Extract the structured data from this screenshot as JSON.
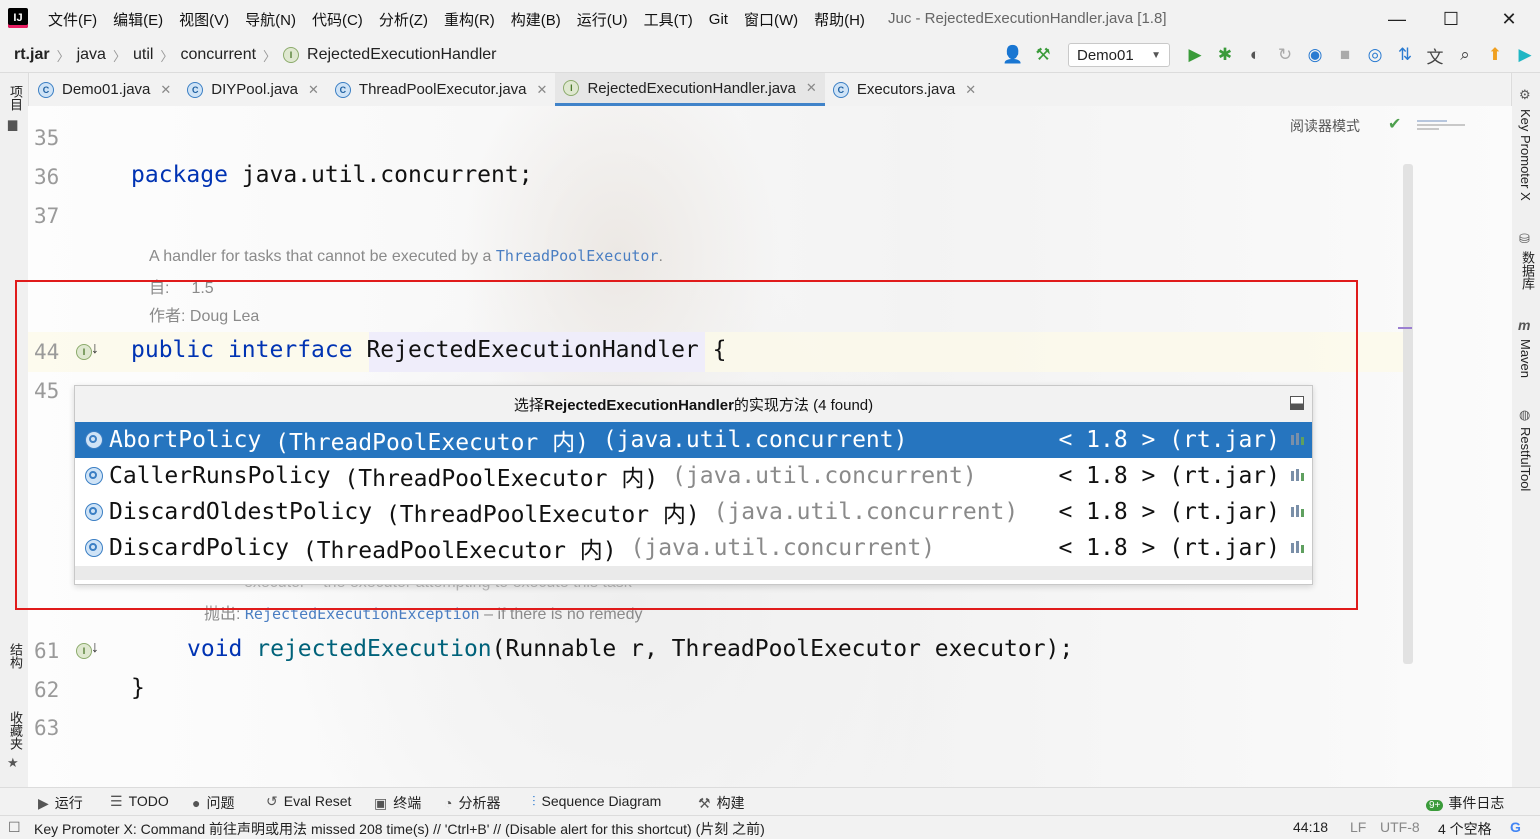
{
  "menubar": {
    "logo": "IJ",
    "items": [
      "文件(F)",
      "编辑(E)",
      "视图(V)",
      "导航(N)",
      "代码(C)",
      "分析(Z)",
      "重构(R)",
      "构建(B)",
      "运行(U)",
      "工具(T)",
      "Git",
      "窗口(W)",
      "帮助(H)"
    ],
    "title": "Juc - RejectedExecutionHandler.java [1.8]"
  },
  "window_controls": {
    "minimize": "—",
    "maximize": "☐",
    "close": "✕"
  },
  "navbar": {
    "breadcrumb": [
      "rt.jar",
      "java",
      "util",
      "concurrent",
      "RejectedExecutionHandler"
    ],
    "run_config": "Demo01"
  },
  "tabs": [
    {
      "label": "Demo01.java",
      "icon": "class-icon"
    },
    {
      "label": "DIYPool.java",
      "icon": "class-icon"
    },
    {
      "label": "ThreadPoolExecutor.java",
      "icon": "class-icon"
    },
    {
      "label": "RejectedExecutionHandler.java",
      "icon": "interface-icon",
      "active": true
    },
    {
      "label": "Executors.java",
      "icon": "class-icon"
    }
  ],
  "left_stripe": {
    "project": "项目",
    "structure": "结构",
    "favorites": "收藏夹"
  },
  "right_stripe": {
    "key_promoter": "Key Promoter X",
    "database": "数据库",
    "maven": "Maven",
    "restful": "RestfulTool"
  },
  "editor": {
    "reader_mode": "阅读器模式",
    "line_numbers": {
      "l35": "35",
      "l36": "36",
      "l37": "37",
      "l44": "44",
      "l45": "45",
      "l61": "61",
      "l62": "62",
      "l63": "63"
    },
    "package_kw": "package",
    "package_name": " java.util.concurrent;",
    "doc": {
      "summary": "A handler for tasks that cannot be executed by a ",
      "summary_link": "ThreadPoolExecutor",
      "summary_end": ".",
      "since_label": "自:",
      "since_value": "1.5",
      "author": "作者: Doug Lea",
      "param_text": "executor – the executor attempting to execute this task",
      "throws_label": "抛出: ",
      "throws_link": "RejectedExecutionException",
      "throws_text": " – if there is no remedy"
    },
    "line44": {
      "kw1": "public",
      "kw2": "interface",
      "name": "RejectedExecutionHandler",
      "brace": "{"
    },
    "line61": {
      "kw": "void",
      "method": "rejectedExecution",
      "params": "(Runnable r, ThreadPoolExecutor executor);"
    },
    "line62": "}"
  },
  "popup": {
    "title_prefix": "选择",
    "title_bold": "RejectedExecutionHandler",
    "title_suffix": "的实现方法 (4 found)",
    "rows": [
      {
        "name": "AbortPolicy",
        "owner": " (ThreadPoolExecutor 内)",
        "pkg": " (java.util.concurrent)",
        "version": "< 1.8 > (rt.jar)",
        "selected": true
      },
      {
        "name": "CallerRunsPolicy",
        "owner": " (ThreadPoolExecutor 内)",
        "pkg": " (java.util.concurrent)",
        "version": "< 1.8 > (rt.jar)"
      },
      {
        "name": "DiscardOldestPolicy",
        "owner": " (ThreadPoolExecutor 内)",
        "pkg": " (java.util.concurrent)",
        "version": "< 1.8 > (rt.jar)"
      },
      {
        "name": "DiscardPolicy",
        "owner": " (ThreadPoolExecutor 内)",
        "pkg": " (java.util.concurrent)",
        "version": "< 1.8 > (rt.jar)"
      }
    ]
  },
  "bottom_tools": [
    "运行",
    "TODO",
    "问题",
    "Eval Reset",
    "终端",
    "分析器",
    "Sequence Diagram",
    "构建"
  ],
  "event_log": "事件日志",
  "event_badge": "9+",
  "status": {
    "message": "Key Promoter X: Command 前往声明或用法 missed 208 time(s) // 'Ctrl+B' // (Disable alert for this shortcut) (片刻 之前)",
    "position": "44:18",
    "line_sep": "LF",
    "encoding": "UTF-8",
    "indent": "4 个空格"
  },
  "colors": {
    "accent": "#2675bf",
    "annotation_red": "#e01b1b",
    "keyword": "#0033b3"
  }
}
